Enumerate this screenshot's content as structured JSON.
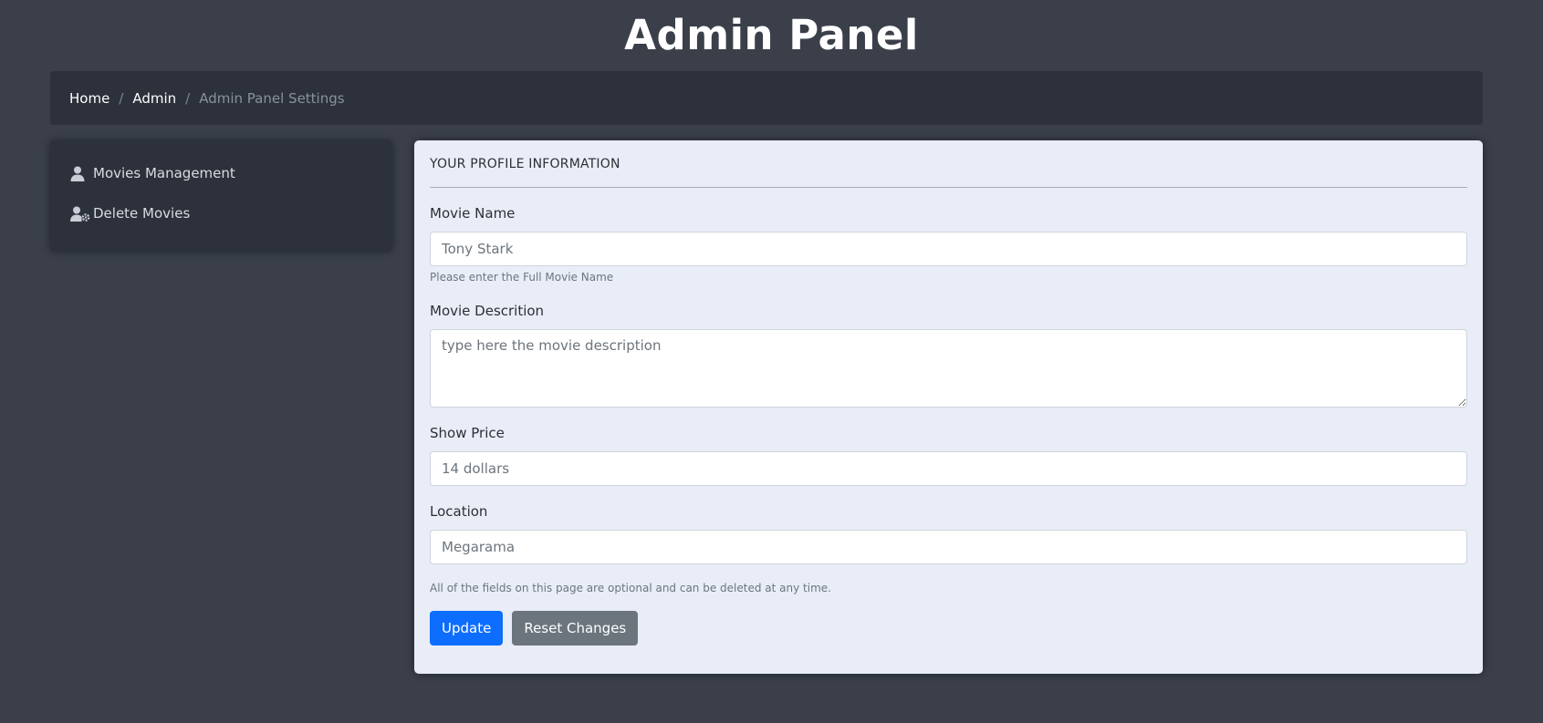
{
  "header": {
    "title": "Admin Panel"
  },
  "breadcrumb": {
    "items": [
      {
        "label": "Home"
      },
      {
        "label": "Admin"
      }
    ],
    "separator": "/",
    "active": "Admin Panel Settings"
  },
  "sidebar": {
    "items": [
      {
        "label": "Movies Management",
        "icon": "user-icon"
      },
      {
        "label": "Delete Movies",
        "icon": "user-gear-icon"
      }
    ]
  },
  "form": {
    "heading": "YOUR PROFILE INFORMATION",
    "movie_name": {
      "label": "Movie Name",
      "placeholder": "Tony Stark",
      "help": "Please enter the Full Movie Name"
    },
    "movie_description": {
      "label": "Movie Descrition",
      "placeholder": "type here the movie description"
    },
    "show_price": {
      "label": "Show Price",
      "placeholder": "14 dollars"
    },
    "location": {
      "label": "Location",
      "placeholder": "Megarama"
    },
    "footnote": "All of the fields on this page are optional and can be deleted at any time.",
    "update_label": "Update",
    "reset_label": "Reset Changes"
  },
  "colors": {
    "background": "#3a3f4a",
    "panel": "#2c313b",
    "card": "#e9edf7",
    "primary": "#0d6efd",
    "secondary": "#6c757d"
  }
}
